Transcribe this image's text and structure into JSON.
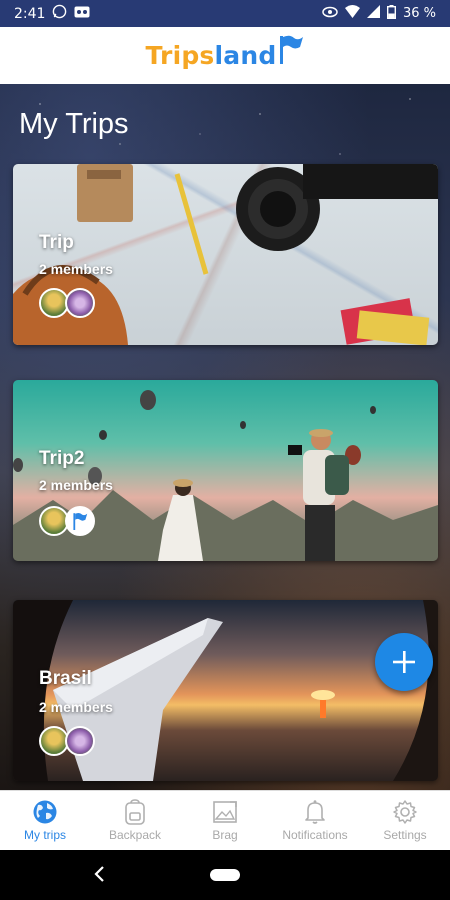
{
  "status_bar": {
    "time": "2:41",
    "battery": "36 %"
  },
  "app_bar": {
    "logo_part1": "Trips",
    "logo_part2": "land"
  },
  "page": {
    "title": "My Trips"
  },
  "trips": [
    {
      "name": "Trip",
      "members": "2 members"
    },
    {
      "name": "Trip2",
      "members": "2 members"
    },
    {
      "name": "Brasil",
      "members": "2 members"
    }
  ],
  "bottom_nav": [
    {
      "label": "My trips",
      "icon": "globe-icon",
      "active": true
    },
    {
      "label": "Backpack",
      "icon": "backpack-icon",
      "active": false
    },
    {
      "label": "Brag",
      "icon": "image-icon",
      "active": false
    },
    {
      "label": "Notifications",
      "icon": "bell-icon",
      "active": false
    },
    {
      "label": "Settings",
      "icon": "gear-icon",
      "active": false
    }
  ],
  "colors": {
    "accent": "#2b86e4",
    "logo_orange": "#f5a623",
    "status_bar": "#283a74",
    "fab": "#1e88e5"
  }
}
